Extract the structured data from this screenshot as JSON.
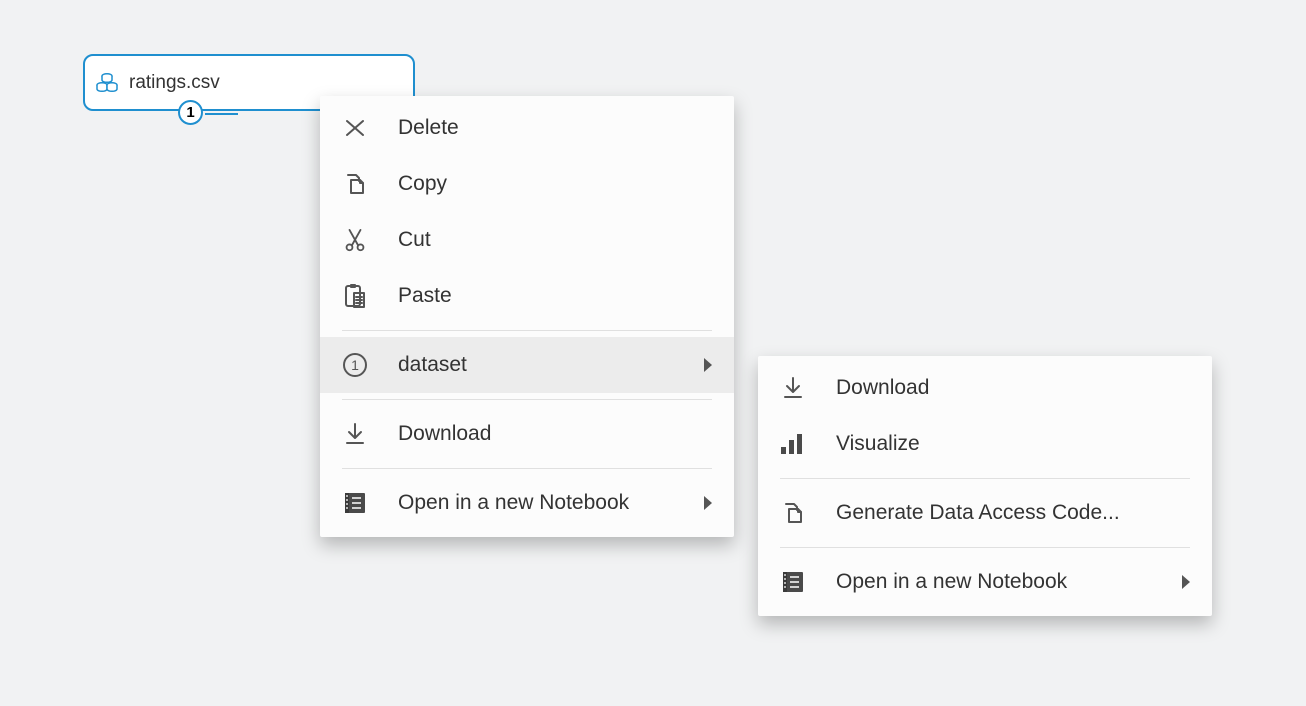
{
  "node": {
    "label": "ratings.csv",
    "port_number": "1"
  },
  "menu_primary": {
    "items": [
      {
        "label": "Delete",
        "icon": "x-icon",
        "arrow": false,
        "sep": false
      },
      {
        "label": "Copy",
        "icon": "copy-icon",
        "arrow": false,
        "sep": false
      },
      {
        "label": "Cut",
        "icon": "scissors-icon",
        "arrow": false,
        "sep": false
      },
      {
        "label": "Paste",
        "icon": "clipboard-icon",
        "arrow": false,
        "sep": true
      },
      {
        "label": "dataset",
        "icon": "circle-1-icon",
        "arrow": true,
        "sep": true,
        "highlight": true
      },
      {
        "label": "Download",
        "icon": "download-icon",
        "arrow": false,
        "sep": true
      },
      {
        "label": "Open in a new Notebook",
        "icon": "notebook-icon",
        "arrow": true,
        "sep": false
      }
    ]
  },
  "menu_submenu": {
    "items": [
      {
        "label": "Download",
        "icon": "download-icon",
        "arrow": false,
        "sep": false
      },
      {
        "label": "Visualize",
        "icon": "bars-icon",
        "arrow": false,
        "sep": true
      },
      {
        "label": "Generate Data Access Code...",
        "icon": "copy-icon",
        "arrow": false,
        "sep": true
      },
      {
        "label": "Open in a new Notebook",
        "icon": "notebook-icon",
        "arrow": true,
        "sep": false
      }
    ]
  }
}
